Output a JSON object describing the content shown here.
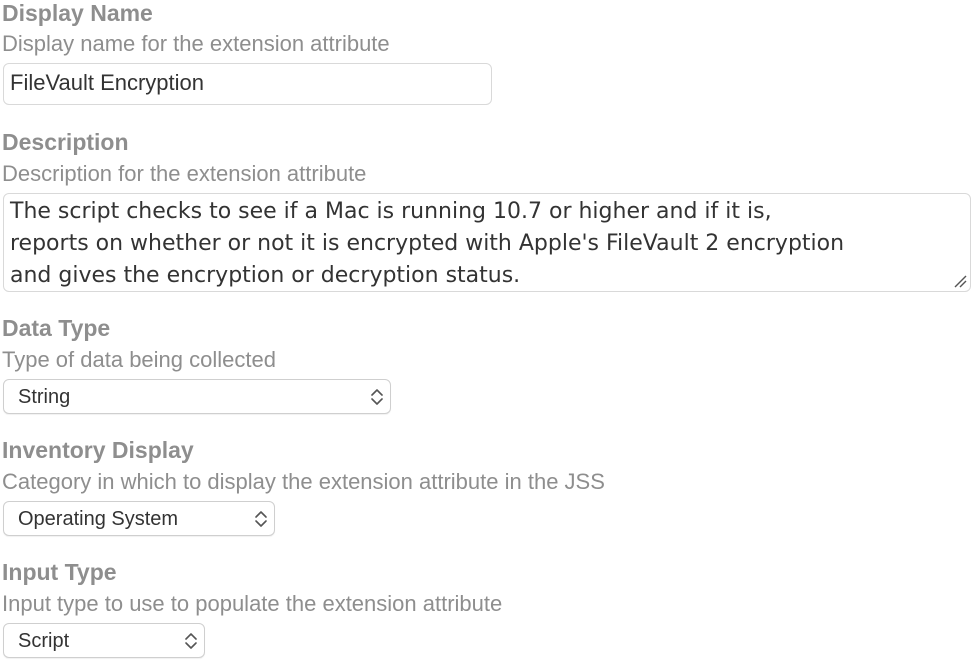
{
  "display_name": {
    "label": "Display Name",
    "help": "Display name for the extension attribute",
    "value": "FileVault Encryption"
  },
  "description": {
    "label": "Description",
    "help": "Description for the extension attribute",
    "lines": [
      "The script checks to see if a Mac is running 10.7 or higher and if it is,",
      "reports on whether or not it is encrypted with Apple's FileVault 2 encryption",
      "and gives the encryption or decryption status."
    ]
  },
  "data_type": {
    "label": "Data Type",
    "help": "Type of data being collected",
    "selected": "String"
  },
  "inventory_display": {
    "label": "Inventory Display",
    "help": "Category in which to display the extension attribute in the JSS",
    "selected": "Operating System"
  },
  "input_type": {
    "label": "Input Type",
    "help": "Input type to use to populate the extension attribute",
    "selected": "Script"
  },
  "icons": {
    "select_chevron": "chevron-up-down-icon",
    "textarea_grip": "resize-grip-icon"
  }
}
